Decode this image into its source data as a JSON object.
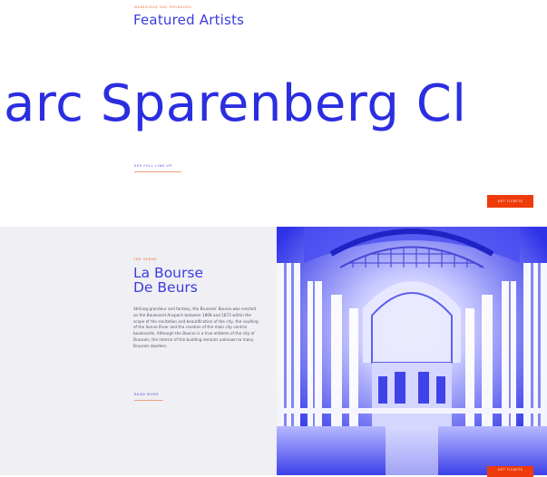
{
  "featured": {
    "eyebrow": "MAINSTAGE DAY SPONSORS",
    "title": "Featured Artists",
    "marquee": "arc Sparenberg Cl",
    "lineup_link": "SEE FULL LINE-UP",
    "ticket_button": "GET TICKETS"
  },
  "venue": {
    "label": "THE VENUE",
    "title_line1": "La Bourse",
    "title_line2": "De Beurs",
    "description": "Striking grandeur and fantasy, the Brussels' Bourse was erected on the Boulevard Anspach between 1868 and 1873 within the scope of the sanitation and beautification of the city, the vaulting of the Senne River and the creation of the main city central boulevards. Although the Bourse is a true emblem of the city of Brussels, the interior of the building remains unknown to many Brussels dwellers.",
    "read_more": "READ MORE",
    "ticket_button": "GET TICKETS"
  },
  "colors": {
    "accent_blue": "#3a3ddc",
    "accent_orange": "#ef3a0a",
    "panel_bg": "#efeff4"
  }
}
